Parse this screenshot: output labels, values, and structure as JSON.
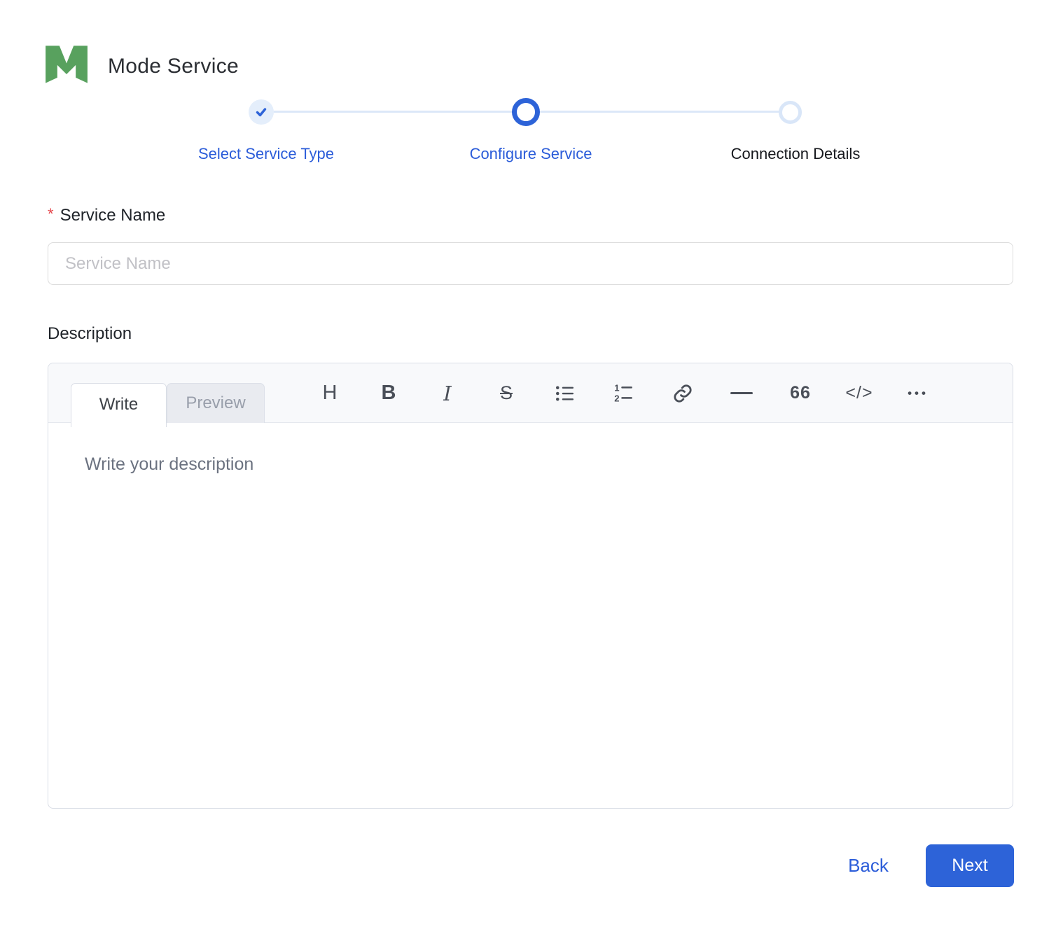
{
  "colors": {
    "primary_blue": "#2d63d8",
    "light_blue": "#dce8f8",
    "logo_green": "#58a15e",
    "required_red": "#e5484d"
  },
  "header": {
    "title": "Mode Service"
  },
  "stepper": {
    "steps": [
      {
        "label": "Select Service Type",
        "state": "completed"
      },
      {
        "label": "Configure Service",
        "state": "active"
      },
      {
        "label": "Connection Details",
        "state": "upcoming"
      }
    ]
  },
  "form": {
    "service_name": {
      "label": "Service Name",
      "required_marker": "*",
      "value": "",
      "placeholder": "Service Name"
    },
    "description": {
      "label": "Description",
      "value": "",
      "placeholder": "Write your description",
      "tabs": [
        {
          "label": "Write",
          "active": true
        },
        {
          "label": "Preview",
          "active": false
        }
      ],
      "toolbar": [
        {
          "name": "heading",
          "glyph": "H"
        },
        {
          "name": "bold",
          "glyph": "B"
        },
        {
          "name": "italic",
          "glyph": "I"
        },
        {
          "name": "strikethrough",
          "glyph": "S"
        },
        {
          "name": "unordered-list"
        },
        {
          "name": "ordered-list"
        },
        {
          "name": "link"
        },
        {
          "name": "horizontal-rule"
        },
        {
          "name": "quote",
          "glyph": "66"
        },
        {
          "name": "code",
          "glyph": "</>"
        },
        {
          "name": "more",
          "glyph": "•••"
        }
      ]
    }
  },
  "footer": {
    "back_label": "Back",
    "next_label": "Next"
  }
}
